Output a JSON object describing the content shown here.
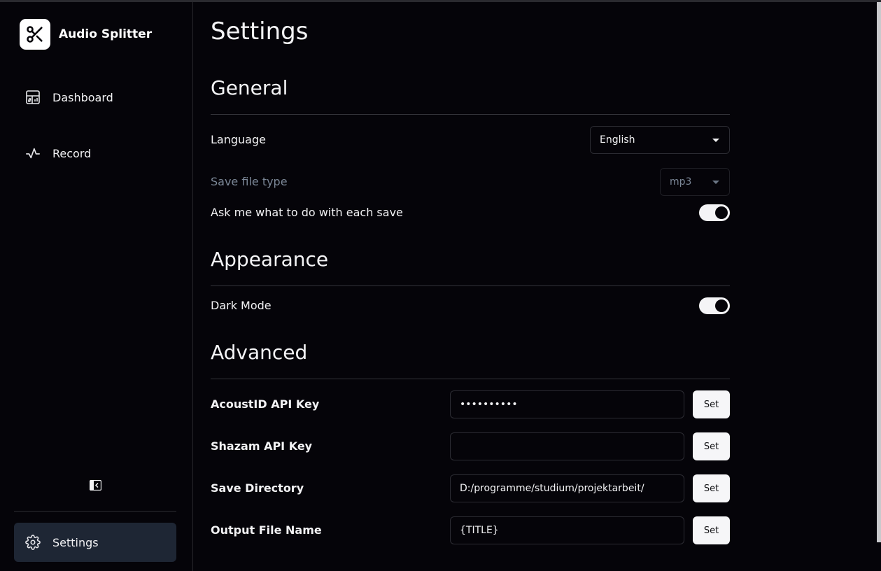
{
  "app": {
    "name": "Audio Splitter",
    "logo_icon": "scissors-icon"
  },
  "sidebar": {
    "items": [
      {
        "label": "Dashboard",
        "icon": "dashboard-icon"
      },
      {
        "label": "Record",
        "icon": "activity-icon"
      }
    ],
    "collapse_icon": "collapse-sidebar-icon",
    "settings": {
      "label": "Settings",
      "icon": "gear-icon",
      "active": true
    }
  },
  "page": {
    "title": "Settings"
  },
  "general": {
    "title": "General",
    "language": {
      "label": "Language",
      "value": "English"
    },
    "file_type": {
      "label": "Save file type",
      "value": "mp3",
      "disabled": true
    },
    "ask_each_save": {
      "label": "Ask me what to do with each save",
      "on": true
    }
  },
  "appearance": {
    "title": "Appearance",
    "dark_mode": {
      "label": "Dark Mode",
      "on": true
    }
  },
  "advanced": {
    "title": "Advanced",
    "set_label": "Set",
    "fields": [
      {
        "label": "AcoustID API Key",
        "value": "••••••••••",
        "placeholder": ""
      },
      {
        "label": "Shazam API Key",
        "value": "",
        "placeholder": ""
      },
      {
        "label": "Save Directory",
        "value": "D:/programme/studium/projektarbeit/",
        "placeholder": ""
      },
      {
        "label": "Output File Name",
        "value": "{TITLE}",
        "placeholder": ""
      }
    ]
  },
  "colors": {
    "background": "#050409",
    "active_nav": "#1e2634",
    "muted_text": "#7b8797",
    "accent": "#f4f4f6"
  }
}
